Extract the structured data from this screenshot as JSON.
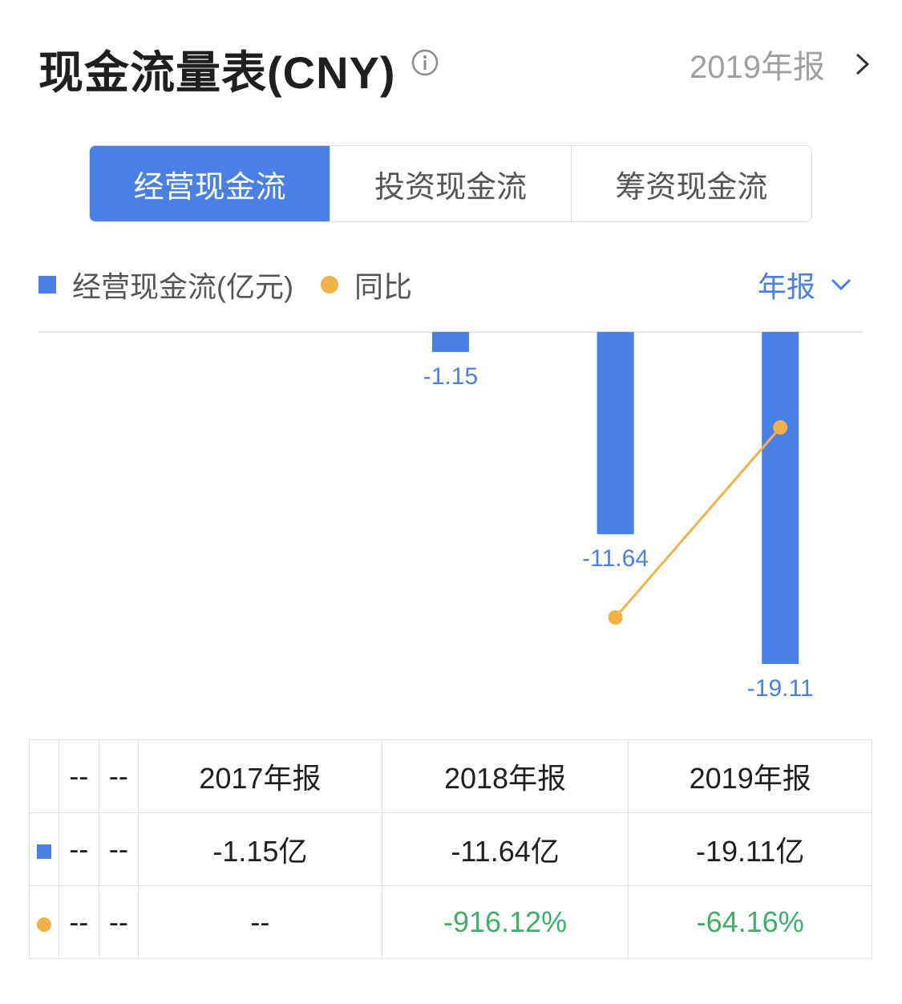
{
  "header": {
    "title": "现金流量表(CNY)",
    "report_label": "2019年报"
  },
  "tabs": [
    {
      "label": "经营现金流",
      "active": true
    },
    {
      "label": "投资现金流",
      "active": false
    },
    {
      "label": "筹资现金流",
      "active": false
    }
  ],
  "legend": {
    "series1": "经营现金流(亿元)",
    "series2": "同比",
    "period": "年报"
  },
  "colors": {
    "bar": "#4a7fe6",
    "line": "#f1b24a",
    "positive_text": "#3fae6a",
    "axis": "#e6e6e6"
  },
  "chart_data": {
    "type": "bar",
    "categories": [
      "--",
      "--",
      "2017年报",
      "2018年报",
      "2019年报"
    ],
    "series": [
      {
        "name": "经营现金流(亿元)",
        "values": [
          null,
          null,
          -1.15,
          -11.64,
          -19.11
        ],
        "labels": [
          "",
          "",
          "-1.15",
          "-11.64",
          "-19.11"
        ]
      },
      {
        "name": "同比",
        "values": [
          null,
          null,
          null,
          -916.12,
          -64.16
        ]
      }
    ],
    "ylim": [
      -19.11,
      0
    ]
  },
  "table": {
    "header": [
      "--",
      "--",
      "2017年报",
      "2018年报",
      "2019年报"
    ],
    "rows": [
      {
        "marker": "bar",
        "cells": [
          "--",
          "--",
          "-1.15亿",
          "-11.64亿",
          "-19.11亿"
        ]
      },
      {
        "marker": "dot",
        "cells": [
          "--",
          "--",
          "--",
          "-916.12%",
          "-64.16%"
        ]
      }
    ]
  }
}
